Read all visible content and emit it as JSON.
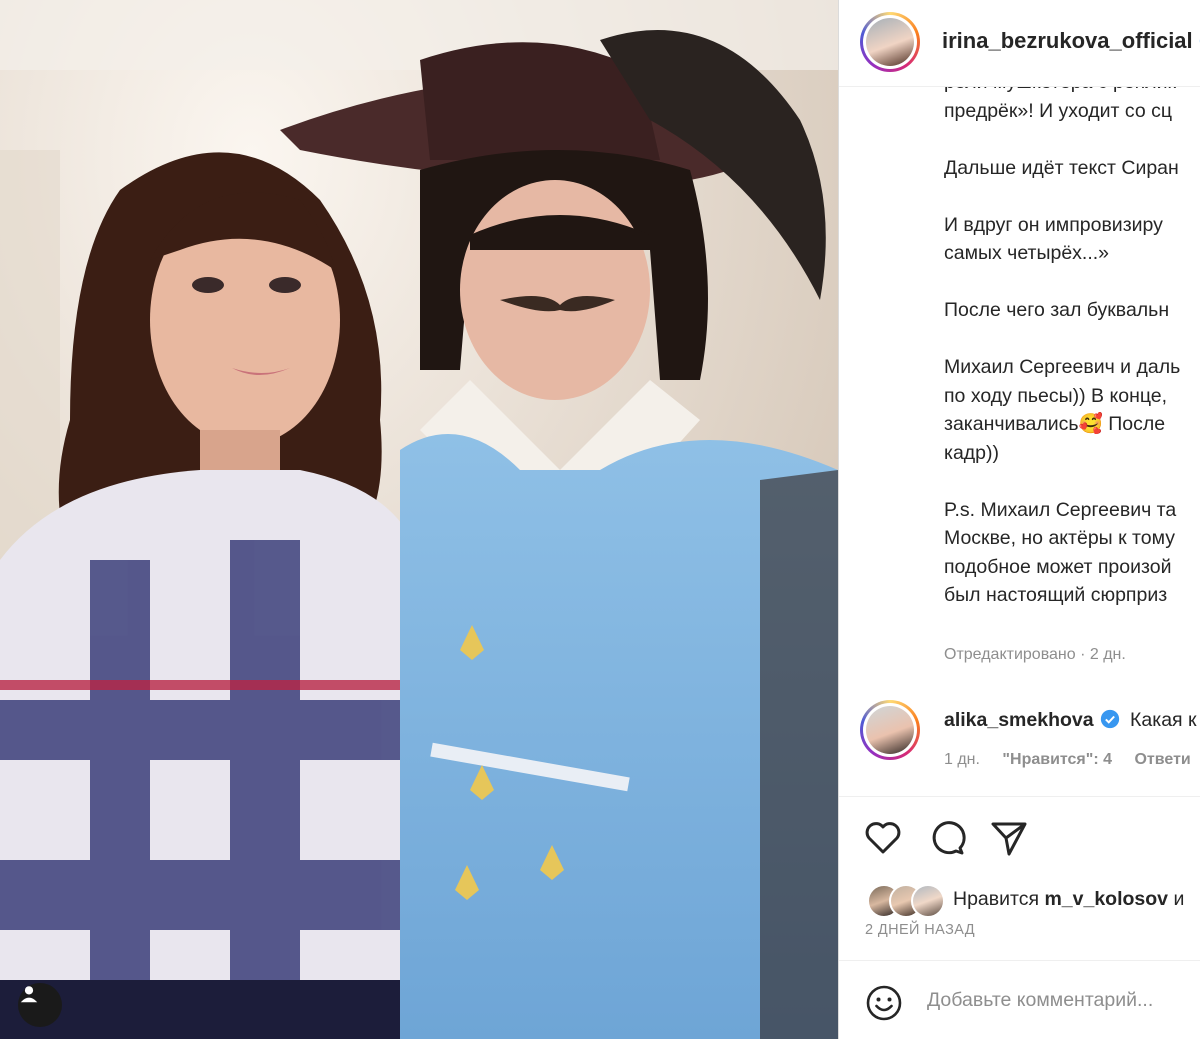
{
  "post": {
    "author": "irina_bezrukova_official",
    "caption_lines": [
      "роли мушкетёра с реплик",
      "предрёк»! И уходит со сц",
      "",
      "Дальше идёт текст Сиран",
      "",
      "И вдруг он импровизиру",
      "самых четырёх...»",
      "",
      "После чего зал буквальн",
      "",
      "Михаил Сергеевич и даль",
      "по ходу пьесы)) В конце,",
      "заканчивались🥰 После",
      "кадр))",
      "",
      "P.s. Михаил Сергеевич та",
      "Москве, но актёры к тому",
      "подобное может произой",
      "был настоящий сюрприз"
    ],
    "edited_label": "Отредактировано · 2 дн."
  },
  "comment": {
    "username": "alika_smekhova",
    "text": "Какая к",
    "time": "1 дн.",
    "likes": "\"Нравится\": 4",
    "reply": "Ответи"
  },
  "actions": {
    "like_icon": "heart-icon",
    "comment_icon": "comment-icon",
    "share_icon": "send-icon"
  },
  "likes": {
    "prefix": "Нравится",
    "user": "m_v_kolosov",
    "suffix": "и"
  },
  "timestamp": "2 ДНЕЙ НАЗАД",
  "add_comment": {
    "placeholder": "Добавьте комментарий..."
  },
  "colors": {
    "verified": "#3897f0",
    "muted": "#8e8e8e",
    "text": "#262626"
  }
}
